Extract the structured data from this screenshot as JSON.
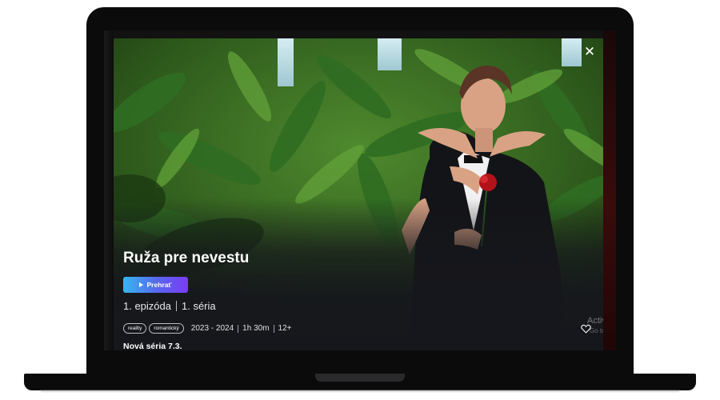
{
  "show": {
    "title": "Ruža pre nevestu",
    "play_label": "Prehrať",
    "episode": "1. epizóda",
    "season": "1. séria",
    "tags": [
      "reality",
      "romantický"
    ],
    "years": "2023 - 2024",
    "duration": "1h 30m",
    "age_rating": "12+",
    "announcement": "Nová séria 7.3."
  },
  "overlay": {
    "activate_text": "Activat",
    "activate_sub": "Go to Set"
  },
  "icons": {
    "close": "close-icon",
    "play": "play-icon",
    "heart": "heart-icon"
  },
  "colors": {
    "play_gradient_start": "#35b7ef",
    "play_gradient_end": "#7b3cf2",
    "modal_bg": "#16171c"
  }
}
